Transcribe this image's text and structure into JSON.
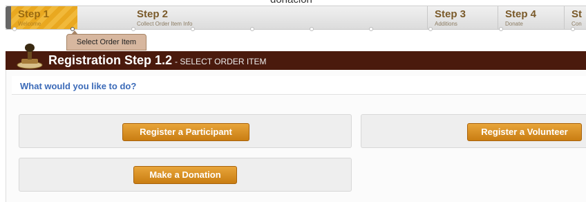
{
  "top_cut_text": "donación",
  "steps": [
    {
      "title": "Step 1",
      "subtitle": "Welcome"
    },
    {
      "title": "Step 2",
      "subtitle": "Collect Order Item Info"
    },
    {
      "title": "Step 3",
      "subtitle": "Additions"
    },
    {
      "title": "Step 4",
      "subtitle": "Donate"
    },
    {
      "title": "St",
      "subtitle": "Con"
    }
  ],
  "tooltip": "Select Order Item",
  "header": {
    "title": "Registration Step 1.2",
    "subtitle": "- SELECT ORDER ITEM"
  },
  "question": "What would you like to do?",
  "buttons": {
    "participant": "Register a Participant",
    "volunteer": "Register a Volunteer",
    "donation": "Make a Donation"
  },
  "colors": {
    "accent": "#e9a820",
    "header_bg": "#4a1a0d",
    "question": "#3b6ab8",
    "button": "#c97d12"
  }
}
